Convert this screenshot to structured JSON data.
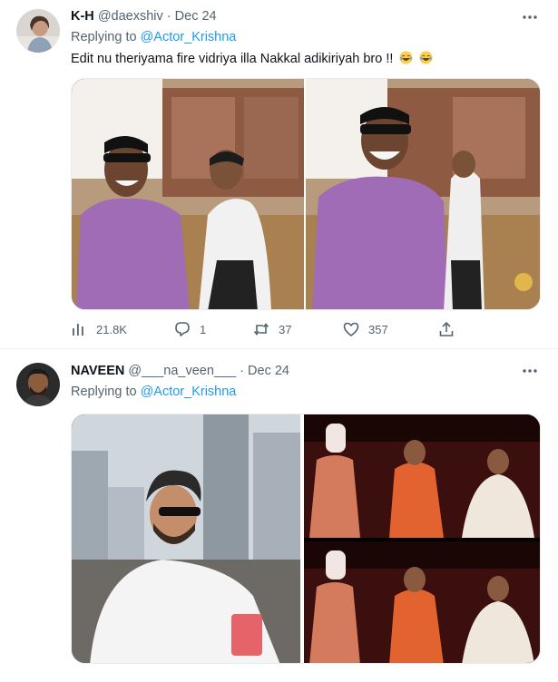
{
  "tweets": [
    {
      "name": "K-H",
      "handle": "@daexshiv",
      "separator": "·",
      "date": "Dec 24",
      "replying_prefix": "Replying to ",
      "replying_to": "@Actor_Krishna",
      "text": "Edit nu theriyama fire vidriya illa Nakkal adikiriyah bro !!",
      "stats": {
        "views": "21.8K",
        "replies": "1",
        "retweets": "37",
        "likes": "357"
      },
      "icons": [
        "avatar",
        "more-icon",
        "laughing-emoji-icon",
        "views-icon",
        "reply-icon",
        "retweet-icon",
        "like-icon",
        "share-icon"
      ]
    },
    {
      "name": "NAVEEN",
      "handle": "@___na_veen___",
      "separator": "·",
      "date": "Dec 24",
      "replying_prefix": "Replying to ",
      "replying_to": "@Actor_Krishna",
      "icons": [
        "avatar",
        "more-icon"
      ]
    }
  ],
  "colors": {
    "link": "#1d9bf0",
    "muted": "#536471",
    "text": "#0f1419",
    "divider": "#eff3f4"
  }
}
